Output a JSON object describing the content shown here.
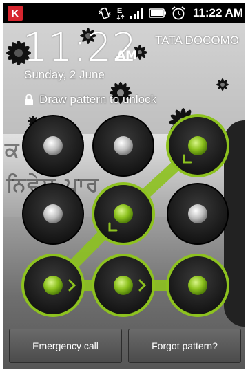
{
  "status_bar": {
    "time": "11:22",
    "time_suffix": "AM",
    "icons": [
      "kaspersky-icon",
      "vibrate-icon",
      "data-e-icon",
      "signal-icon",
      "battery-icon",
      "alarm-icon"
    ]
  },
  "lockscreen": {
    "clock_time": "11:22",
    "clock_ampm": "AM",
    "carrier": "TATA DOCOMO",
    "date": "Sunday, 2 June",
    "instruction": "Draw pattern to unlock"
  },
  "pattern": {
    "accent_color": "#8dc21f",
    "dots": [
      {
        "index": 0,
        "state": "idle"
      },
      {
        "index": 1,
        "state": "idle"
      },
      {
        "index": 2,
        "state": "selected",
        "arrow": "down-left"
      },
      {
        "index": 3,
        "state": "idle"
      },
      {
        "index": 4,
        "state": "selected",
        "arrow": "down-left"
      },
      {
        "index": 5,
        "state": "idle"
      },
      {
        "index": 6,
        "state": "selected",
        "arrow": "right"
      },
      {
        "index": 7,
        "state": "selected",
        "arrow": "right"
      },
      {
        "index": 8,
        "state": "selected"
      }
    ],
    "sequence": [
      2,
      4,
      6,
      7,
      8
    ]
  },
  "buttons": {
    "emergency_label": "Emergency call",
    "forgot_label": "Forgot pattern?"
  }
}
